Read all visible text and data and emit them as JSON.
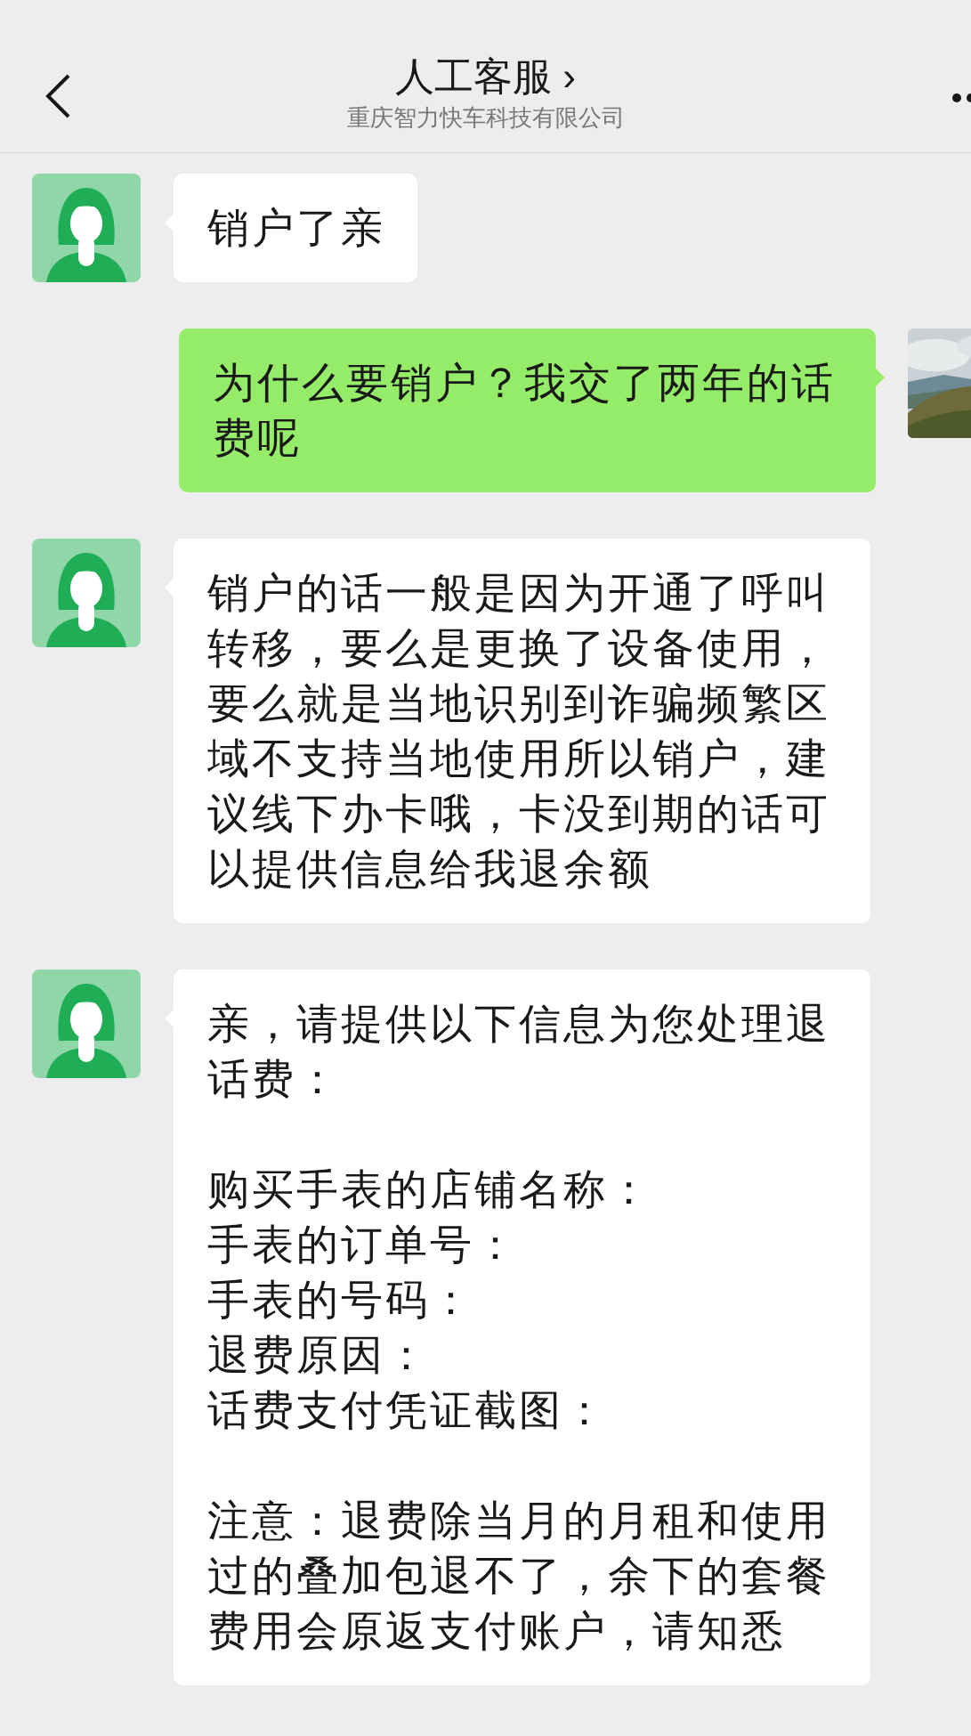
{
  "header": {
    "title": "人工客服",
    "title_chevron": "›",
    "subtitle": "重庆智力快车科技有限公司"
  },
  "messages": [
    {
      "kind": "received",
      "paragraphs": [
        [
          "销户了亲"
        ]
      ]
    },
    {
      "kind": "sent",
      "paragraphs": [
        [
          "为什么要销户？我交了两年的话费呢"
        ]
      ]
    },
    {
      "kind": "received",
      "paragraphs": [
        [
          "销户的话一般是因为开通了呼叫转移，要么是更换了设备使用，要么就是当地识别到诈骗频繁区域不支持当地使用所以销户，建议线下办卡哦，卡没到期的话可以提供信息给我退余额"
        ]
      ]
    },
    {
      "kind": "received",
      "paragraphs": [
        [
          "亲，请提供以下信息为您处理退话费："
        ],
        [
          "购买手表的店铺名称：",
          "手表的订单号：",
          "手表的号码：",
          "退费原因：",
          "话费支付凭证截图："
        ],
        [
          "注意：退费除当月的月租和使用过的叠加包退不了，余下的套餐费用会原返支付账户，请知悉"
        ]
      ]
    }
  ]
}
